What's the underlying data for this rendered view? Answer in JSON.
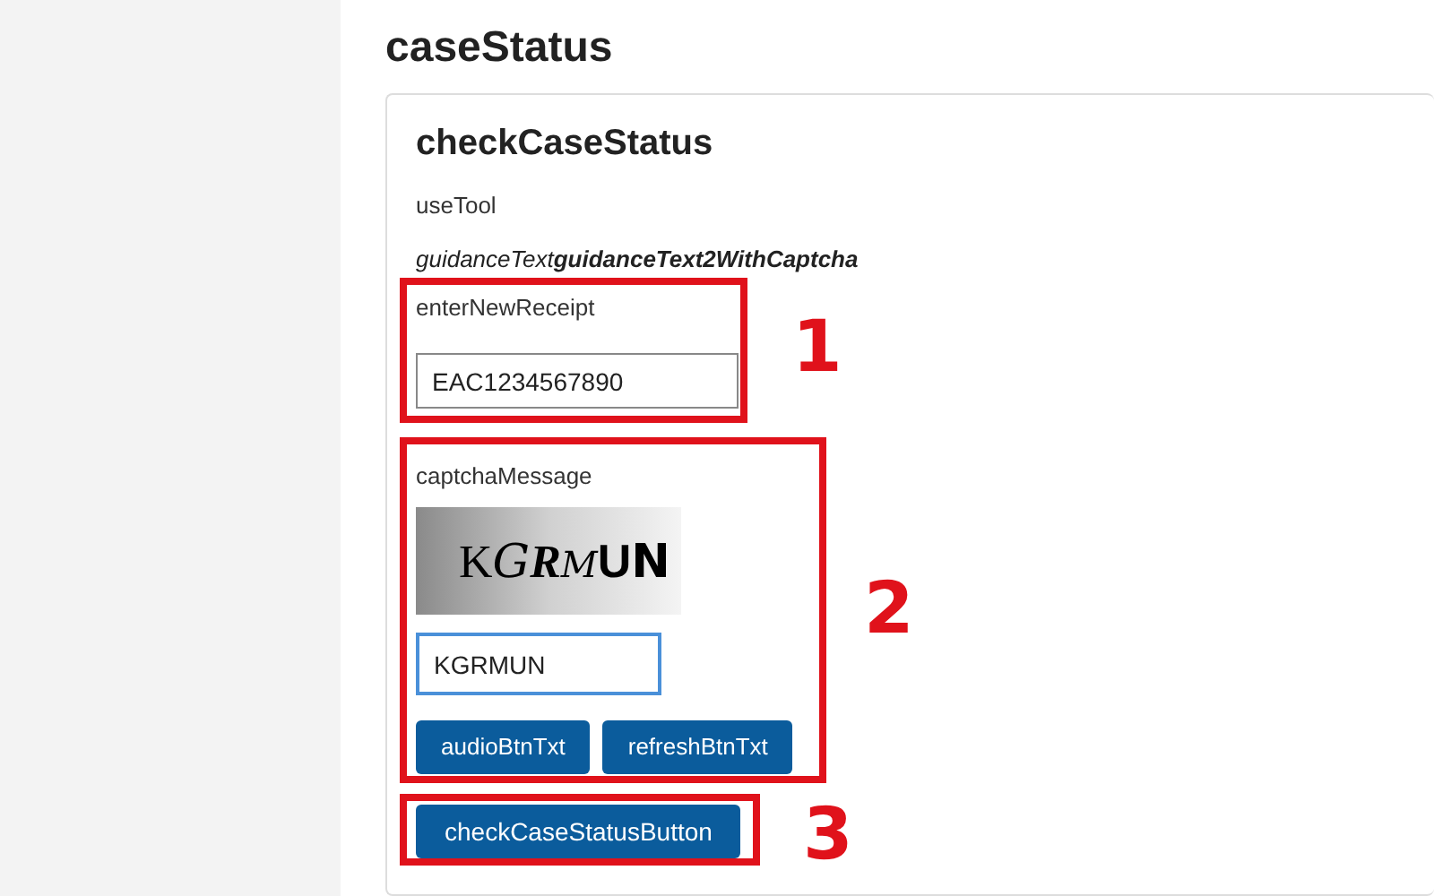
{
  "page_title": "caseStatus",
  "card": {
    "title": "checkCaseStatus",
    "intro": "useTool",
    "guidance": "guidanceText**guidanceText2WithCaptcha**",
    "receipt": {
      "label": "enterNewReceipt",
      "value": "EAC1234567890",
      "focused": false
    },
    "captcha": {
      "label": "captchaMessage",
      "image_text": "KGRMUN",
      "input": {
        "value": "KGRMUN",
        "focused": true
      },
      "buttons": [
        "audioBtnTxt",
        "refreshBtnTxt"
      ]
    },
    "submit_button": "checkCaseStatusButton"
  },
  "annotations": [
    {
      "number": "1"
    },
    {
      "number": "2"
    },
    {
      "number": "3"
    }
  ]
}
